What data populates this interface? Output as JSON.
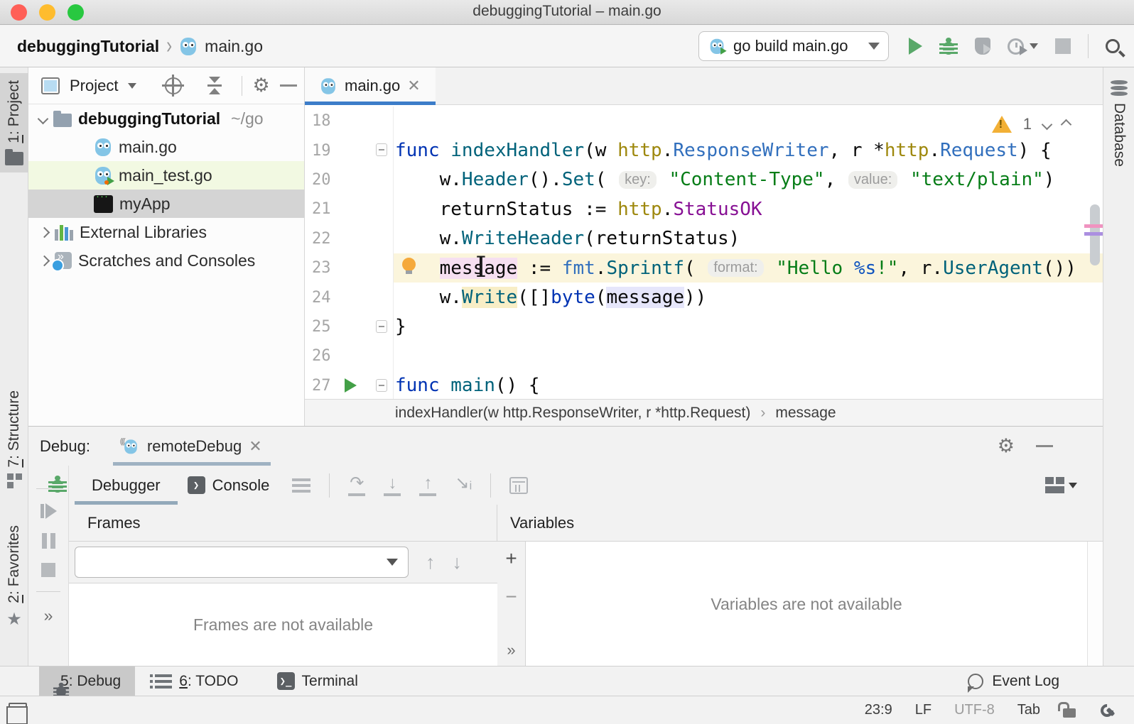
{
  "window": {
    "title": "debuggingTutorial – main.go"
  },
  "toolbar": {
    "breadcrumb": {
      "project": "debuggingTutorial",
      "file": "main.go"
    },
    "run_config_label": "go build main.go"
  },
  "project": {
    "header_title": "Project",
    "tree": {
      "root": {
        "label": "debuggingTutorial",
        "path": "~/go"
      },
      "items": [
        {
          "label": "main.go"
        },
        {
          "label": "main_test.go"
        },
        {
          "label": "myApp"
        },
        {
          "label": "External Libraries"
        },
        {
          "label": "Scratches and Consoles"
        }
      ]
    }
  },
  "editor": {
    "tab_label": "main.go",
    "warning_count": "1",
    "breadcrumb": {
      "function": "indexHandler(w http.ResponseWriter, r *http.Request)",
      "member": "message"
    },
    "lines": [
      {
        "no": 18,
        "tokens": []
      },
      {
        "no": 19,
        "fold": true,
        "tokens": [
          [
            "func",
            "kw"
          ],
          [
            " ",
            "p"
          ],
          [
            "indexHandler",
            "fn"
          ],
          [
            "(w ",
            "p"
          ],
          [
            "http",
            "pkg"
          ],
          [
            ".",
            "p"
          ],
          [
            "ResponseWriter",
            "type"
          ],
          [
            ", r *",
            "p"
          ],
          [
            "http",
            "pkg"
          ],
          [
            ".",
            "p"
          ],
          [
            "Request",
            "type"
          ],
          [
            ") {",
            "p"
          ]
        ]
      },
      {
        "no": 20,
        "tokens": [
          [
            "    w.",
            "p"
          ],
          [
            "Header",
            "fn"
          ],
          [
            "().",
            "p"
          ],
          [
            "Set",
            "fn"
          ],
          [
            "( ",
            "p"
          ],
          [
            "key:",
            "hint"
          ],
          [
            " ",
            "p"
          ],
          [
            "\"Content-Type\"",
            "str"
          ],
          [
            ", ",
            "p"
          ],
          [
            "value:",
            "hint"
          ],
          [
            " ",
            "p"
          ],
          [
            "\"text/plain\"",
            "str"
          ],
          [
            ")",
            "p"
          ]
        ]
      },
      {
        "no": 21,
        "tokens": [
          [
            "    returnStatus := ",
            "p"
          ],
          [
            "http",
            "pkg"
          ],
          [
            ".",
            "p"
          ],
          [
            "StatusOK",
            "const"
          ]
        ]
      },
      {
        "no": 22,
        "tokens": [
          [
            "    w.",
            "p"
          ],
          [
            "WriteHeader",
            "fn"
          ],
          [
            "(returnStatus)",
            "p"
          ]
        ]
      },
      {
        "no": 23,
        "hl": true,
        "bulb": true,
        "tokens": [
          [
            "    ",
            "p"
          ],
          [
            "message",
            "p",
            "pink"
          ],
          [
            " := ",
            "p"
          ],
          [
            "fmt",
            "type"
          ],
          [
            ".",
            "p"
          ],
          [
            "Sprintf",
            "fn"
          ],
          [
            "( ",
            "p"
          ],
          [
            "format:",
            "hint"
          ],
          [
            " ",
            "p"
          ],
          [
            "\"Hello ",
            "str"
          ],
          [
            "%s",
            "fmt"
          ],
          [
            "!\"",
            "str"
          ],
          [
            ", r.",
            "p"
          ],
          [
            "UserAgent",
            "fn"
          ],
          [
            "())",
            "p"
          ]
        ]
      },
      {
        "no": 24,
        "tokens": [
          [
            "    w.",
            "p"
          ],
          [
            "Write",
            "fn",
            "cream"
          ],
          [
            "([]",
            "p"
          ],
          [
            "byte",
            "kw"
          ],
          [
            "(",
            "p"
          ],
          [
            "message",
            "p",
            "lav"
          ],
          [
            "))",
            "p"
          ]
        ]
      },
      {
        "no": 25,
        "fold": true,
        "tokens": [
          [
            "}",
            "p"
          ]
        ]
      },
      {
        "no": 26,
        "tokens": []
      },
      {
        "no": 27,
        "run": true,
        "fold": true,
        "tokens": [
          [
            "func",
            "kw"
          ],
          [
            " ",
            "p"
          ],
          [
            "main",
            "fn"
          ],
          [
            "() {",
            "p"
          ]
        ]
      }
    ]
  },
  "debug": {
    "panel_label": "Debug:",
    "session_tab": "remoteDebug",
    "tab_debugger": "Debugger",
    "tab_console": "Console",
    "frames_title": "Frames",
    "frames_empty": "Frames are not available",
    "variables_title": "Variables",
    "variables_empty": "Variables are not available"
  },
  "left_stripe": {
    "project": {
      "mn": "1",
      "rest": ": Project"
    },
    "structure": {
      "mn": "7",
      "rest": ": Structure"
    },
    "favorites": {
      "mn": "2",
      "rest": ": Favorites"
    }
  },
  "right_stripe": {
    "database": "Database"
  },
  "bottom_bar": {
    "debug": {
      "mn": "5",
      "rest": ": Debug"
    },
    "todo": {
      "mn": "6",
      "rest": ": TODO"
    },
    "terminal": "Terminal",
    "event_log": "Event Log"
  },
  "status_bar": {
    "caret": "23:9",
    "line_ending": "LF",
    "encoding": "UTF-8",
    "indent": "Tab"
  },
  "colors": {
    "accent_blue": "#3d7dc9",
    "keyword": "#0033b3",
    "function": "#00627a",
    "package": "#9e880d",
    "type": "#316fbd",
    "string": "#067d17",
    "constant": "#871094",
    "run_green": "#59a869",
    "warning_yellow": "#f2b036",
    "selection_gray": "#d4d4d4",
    "test_row_green": "#f2f9e2"
  }
}
